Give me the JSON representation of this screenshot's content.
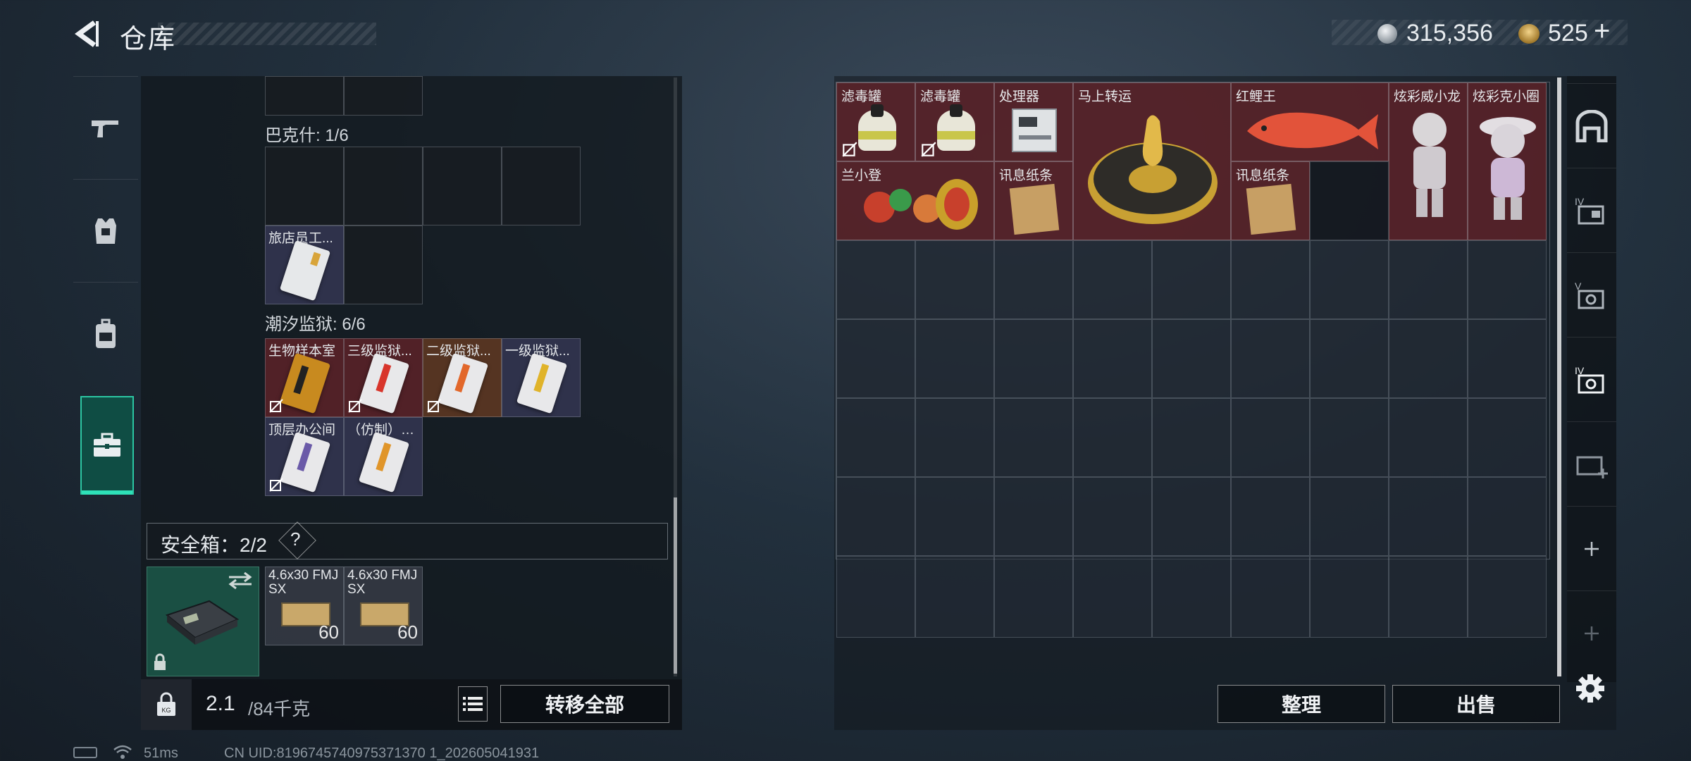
{
  "header": {
    "title": "仓库",
    "currency": {
      "coins": "315,356",
      "bonds": "525",
      "bonds_plus": "+"
    }
  },
  "left_nav": {
    "items": [
      {
        "name": "weapons",
        "icon": "gun-icon"
      },
      {
        "name": "armor",
        "icon": "armor-vest-icon"
      },
      {
        "name": "backpack",
        "icon": "backpack-icon"
      },
      {
        "name": "case",
        "icon": "briefcase-icon",
        "active": true
      }
    ]
  },
  "left_panel": {
    "section_baker": {
      "label": "巴克什: 1/6",
      "items": [
        {
          "label": "旅店员工..."
        }
      ]
    },
    "section_prison": {
      "label": "潮汐监狱: 6/6",
      "items": [
        {
          "label": "生物样本室",
          "rarity": "red"
        },
        {
          "label": "三级监狱...",
          "rarity": "red"
        },
        {
          "label": "二级监狱...",
          "rarity": "orange"
        },
        {
          "label": "一级监狱...",
          "rarity": "blue"
        },
        {
          "label": "顶层办公间",
          "rarity": "blue"
        },
        {
          "label": "（仿制）一...",
          "rarity": "blue"
        }
      ]
    },
    "safebox": {
      "label": "安全箱：2/2",
      "help": "?",
      "ammo": [
        {
          "label": "4.6x30 FMJ SX",
          "count": "60"
        },
        {
          "label": "4.6x30 FMJ SX",
          "count": "60"
        }
      ]
    },
    "weight": {
      "current": "2.1",
      "max": "/84千克"
    },
    "transfer_all": "转移全部"
  },
  "right_panel": {
    "items": [
      {
        "label": "滤毒罐"
      },
      {
        "label": "滤毒罐"
      },
      {
        "label": "处理器"
      },
      {
        "label": "马上转运"
      },
      {
        "label": "红鲤王"
      },
      {
        "label": "炫彩威小龙"
      },
      {
        "label": "炫彩克小圈"
      },
      {
        "label": "兰小登"
      },
      {
        "label": "讯息纸条"
      },
      {
        "label": "讯息纸条"
      }
    ],
    "sort_label": "整理",
    "sell_label": "出售"
  },
  "right_nav": {
    "items": [
      {
        "name": "vault-main",
        "icon": "vault-icon"
      },
      {
        "name": "storage-iv",
        "icon": "storage-iv-icon"
      },
      {
        "name": "storage-v",
        "icon": "storage-v-icon"
      },
      {
        "name": "storage-iv-active",
        "icon": "storage-iv-gear-icon"
      },
      {
        "name": "storage-add",
        "icon": "storage-add-icon"
      },
      {
        "name": "add-1",
        "icon": "plus-icon"
      },
      {
        "name": "add-2",
        "icon": "plus-icon"
      }
    ]
  },
  "status": {
    "ping": "51ms",
    "uid": "CN UID:8196745740975371370 1_202605041931"
  }
}
